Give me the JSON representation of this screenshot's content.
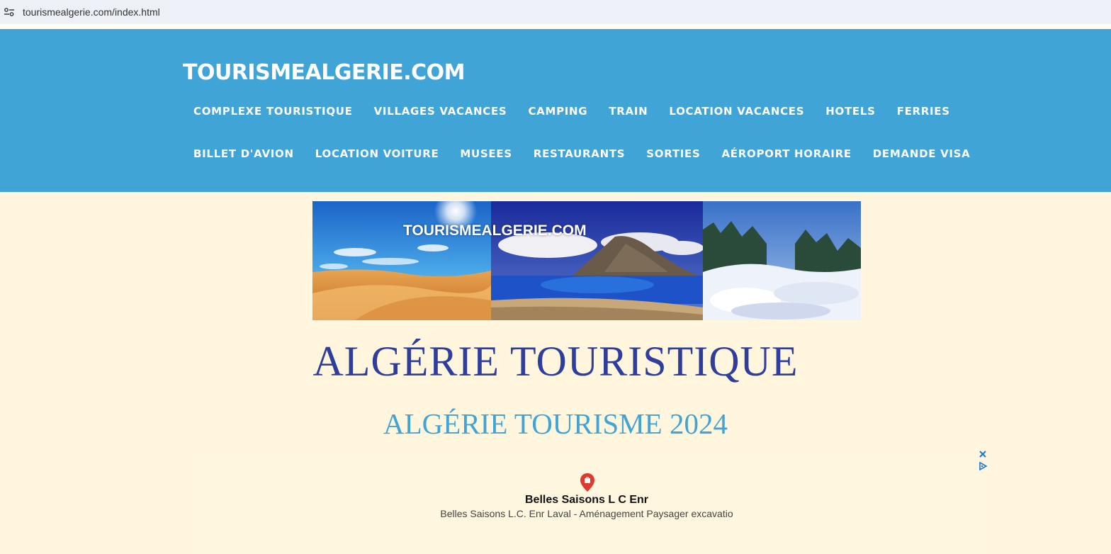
{
  "browser": {
    "url": "tourismealgerie.com/index.html",
    "site_icon": "site-settings-icon"
  },
  "header": {
    "brand": "TOURISMEALGERIE.COM",
    "nav_row1": [
      "COMPLEXE TOURISTIQUE",
      "VILLAGES VACANCES",
      "CAMPING",
      "TRAIN",
      "LOCATION VACANCES",
      "HOTELS",
      "FERRIES"
    ],
    "nav_row2": [
      "BILLET D'AVION",
      "LOCATION VOITURE",
      "MUSEES",
      "RESTAURANTS",
      "SORTIES",
      "AÉROPORT HORAIRE",
      "DEMANDE VISA"
    ]
  },
  "banner": {
    "overlay_text": "TOURISMEALGERIE.COM"
  },
  "main": {
    "title": "ALGÉRIE TOURISTIQUE",
    "subtitle": "ALGÉRIE TOURISME 2024"
  },
  "ad": {
    "business_name": "Belles Saisons L C Enr",
    "description": "Belles Saisons L.C. Enr Laval - Aménagement Paysager excavatio",
    "icons": [
      "close-icon",
      "adchoices-icon",
      "map-pin-icon"
    ]
  },
  "colors": {
    "header_bg": "#41a4d6",
    "page_bg": "#fff6dd",
    "title": "#2e3e9a",
    "subtitle": "#41a4d6"
  }
}
